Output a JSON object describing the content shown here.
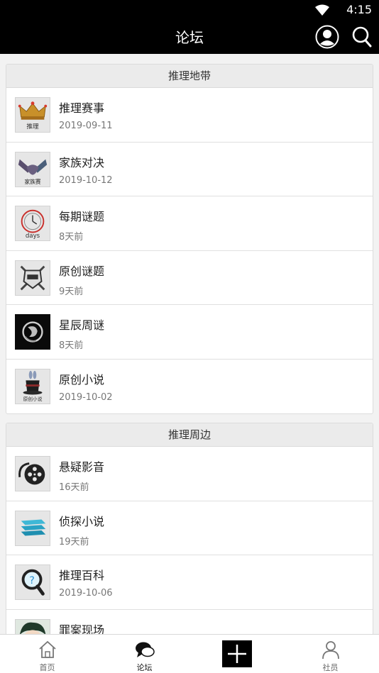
{
  "status_bar": {
    "time": "4:15"
  },
  "header": {
    "title": "论坛"
  },
  "sections": [
    {
      "title": "推理地带",
      "items": [
        {
          "title": "推理赛事",
          "date": "2019-09-11",
          "icon": "crown-icon"
        },
        {
          "title": "家族对决",
          "date": "2019-10-12",
          "icon": "handshake-icon"
        },
        {
          "title": "每期谜题",
          "date": "8天前",
          "icon": "clock-icon"
        },
        {
          "title": "原创谜题",
          "date": "9天前",
          "icon": "badge-icon"
        },
        {
          "title": "星辰周谜",
          "date": "8天前",
          "icon": "seal-icon"
        },
        {
          "title": "原创小说",
          "date": "2019-10-02",
          "icon": "magic-hat-icon"
        }
      ]
    },
    {
      "title": "推理周边",
      "items": [
        {
          "title": "悬疑影音",
          "date": "16天前",
          "icon": "film-reel-icon"
        },
        {
          "title": "侦探小说",
          "date": "19天前",
          "icon": "books-icon"
        },
        {
          "title": "推理百科",
          "date": "2019-10-06",
          "icon": "magnifier-icon"
        },
        {
          "title": "罪案现场",
          "date": "",
          "icon": "character-icon"
        }
      ]
    }
  ],
  "thumb_text": {
    "crown": "推理",
    "handshake": "家族赛",
    "clock": "days",
    "hat": "原创小说"
  },
  "nav": [
    {
      "label": "首页",
      "icon": "home-icon"
    },
    {
      "label": "论坛",
      "icon": "chat-bubble-icon",
      "active": true
    },
    {
      "label": "",
      "icon": "plus-icon"
    },
    {
      "label": "社员",
      "icon": "person-icon"
    }
  ]
}
